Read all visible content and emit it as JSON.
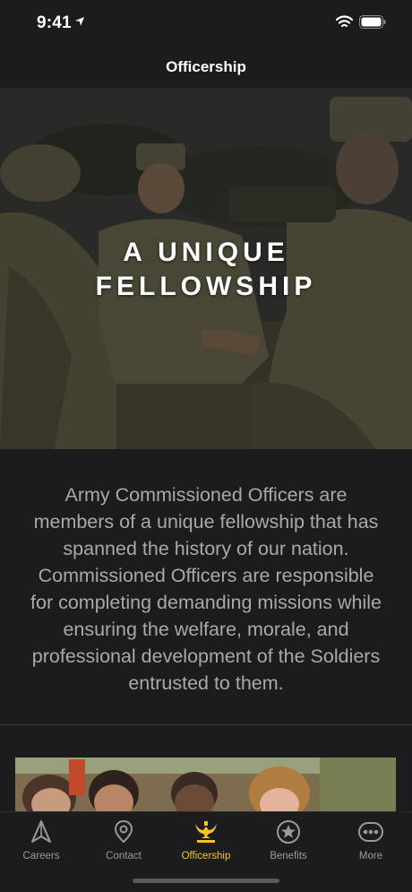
{
  "status_bar": {
    "time": "9:41"
  },
  "nav": {
    "title": "Officership"
  },
  "hero": {
    "title_line1": "A UNIQUE",
    "title_line2": "FELLOWSHIP"
  },
  "intro": {
    "text": "Army Commissioned Officers are members of a unique fellowship that has spanned the history of our nation. Commissioned Officers are responsible for completing demanding missions while ensuring the welfare, morale, and professional development of the Soldiers entrusted to them."
  },
  "tab_bar": {
    "active_color": "#f2c523",
    "items": [
      {
        "label": "Careers",
        "icon": "navigation-arrow-icon"
      },
      {
        "label": "Contact",
        "icon": "location-pin-icon"
      },
      {
        "label": "Officership",
        "icon": "eagle-insignia-icon"
      },
      {
        "label": "Benefits",
        "icon": "star-circle-icon"
      },
      {
        "label": "More",
        "icon": "more-dots-icon"
      }
    ]
  }
}
